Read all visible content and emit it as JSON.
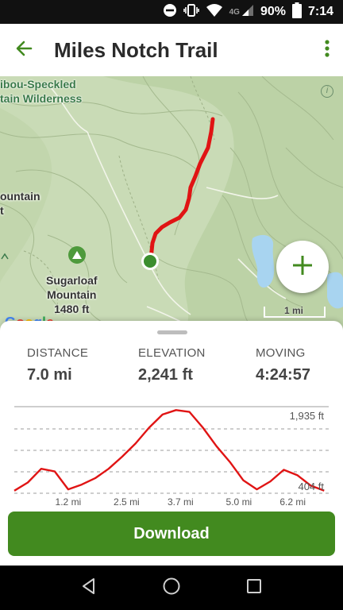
{
  "status_bar": {
    "network": "4G",
    "battery": "90%",
    "time": "7:14",
    "icons": [
      "do-not-disturb-icon",
      "vibrate-icon",
      "wifi-icon",
      "cell-signal-icon",
      "battery-icon"
    ]
  },
  "header": {
    "title": "Miles Notch Trail",
    "back_icon": "back-arrow-icon",
    "menu_icon": "more-vert-icon"
  },
  "map": {
    "labels": {
      "wilderness_line1": "ibou-Speckled",
      "wilderness_line2": "tain Wilderness",
      "mountain_line1": "ountain",
      "mountain_line2": "t",
      "sugarloaf_line1": "Sugarloaf",
      "sugarloaf_line2": "Mountain",
      "sugarloaf_line3": "1480 ft"
    },
    "scale_label": "1 mi",
    "google": "Google",
    "colors": {
      "trail": "#e01414",
      "trailhead": "#3b8e2e",
      "terrain": "#c9dbb6",
      "water": "#a8d4f0"
    }
  },
  "stats": {
    "distance": {
      "label": "DISTANCE",
      "value": "7.0 mi"
    },
    "elevation": {
      "label": "ELEVATION",
      "value": "2,241 ft"
    },
    "moving": {
      "label": "MOVING",
      "value": "4:24:57"
    }
  },
  "elevation_chart": {
    "type": "line",
    "x_unit": "mi",
    "x": [
      0.0,
      0.3,
      0.6,
      0.9,
      1.2,
      1.5,
      1.8,
      2.1,
      2.4,
      2.7,
      3.0,
      3.3,
      3.6,
      3.9,
      4.2,
      4.5,
      4.8,
      5.1,
      5.4,
      5.7,
      6.0,
      6.3,
      6.6,
      6.9
    ],
    "y": [
      404,
      560,
      820,
      770,
      430,
      520,
      640,
      820,
      1050,
      1300,
      1600,
      1850,
      1935,
      1900,
      1600,
      1250,
      950,
      600,
      430,
      580,
      800,
      700,
      500,
      404
    ],
    "ylim": [
      250,
      2000
    ],
    "xlim": [
      0,
      7.0
    ],
    "x_ticks": [
      "1.2 mi",
      "2.5 mi",
      "3.7 mi",
      "5.0 mi",
      "6.2 mi"
    ],
    "x_tick_values": [
      1.2,
      2.5,
      3.7,
      5.0,
      6.2
    ],
    "max_label": "1,935 ft",
    "min_label": "404 ft",
    "line_color": "#e01414",
    "grid": "dashed"
  },
  "download": {
    "label": "Download",
    "color": "#428a1f"
  },
  "nav": {
    "back_icon": "nav-back-icon",
    "home_icon": "nav-home-icon",
    "recents_icon": "nav-recents-icon"
  }
}
